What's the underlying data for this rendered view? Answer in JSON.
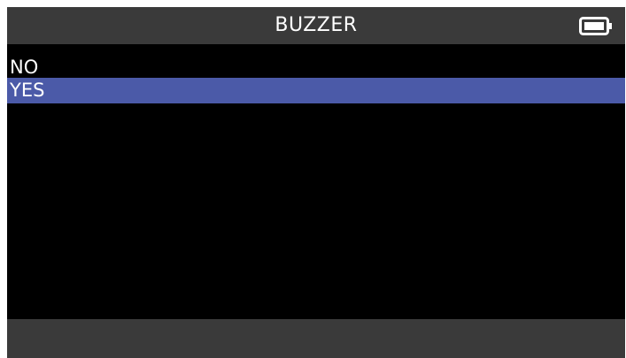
{
  "header": {
    "title": "BUZZER",
    "battery_icon": "battery-full-icon"
  },
  "menu": {
    "items": [
      {
        "label": "NO",
        "selected": false
      },
      {
        "label": "YES",
        "selected": true
      }
    ]
  },
  "colors": {
    "header_bg": "#3a3a3a",
    "screen_bg": "#000000",
    "selection_bg": "#4b5aa8",
    "text": "#ffffff"
  }
}
